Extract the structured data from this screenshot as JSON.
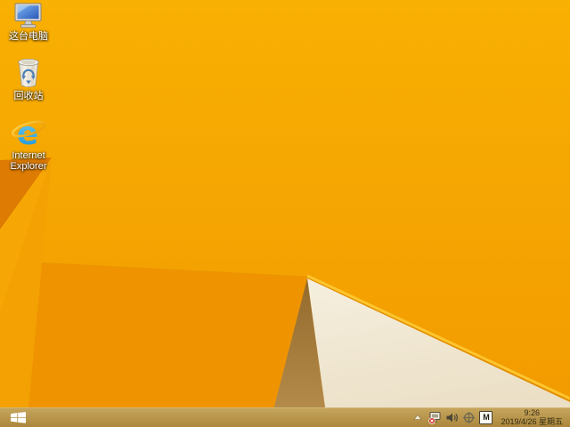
{
  "desktop": {
    "icons": [
      {
        "name": "this-pc",
        "label": "这台电脑"
      },
      {
        "name": "recycle-bin",
        "label": "回收站"
      },
      {
        "name": "internet-explorer",
        "label": "Internet Explorer"
      }
    ]
  },
  "taskbar": {
    "tray": {
      "icon_names": [
        "show-hidden-icons",
        "network-disconnected",
        "volume",
        "input-indicator",
        "ime-mode"
      ],
      "ime_label": "M",
      "time": "9:26",
      "date": "2019/4/26 星期五"
    }
  },
  "colors": {
    "wallpaper_top": "#f8b002",
    "wallpaper_bottom": "#f19500",
    "facet_dark": "#dd7b02",
    "facet_cream": "#f2ecda",
    "facet_tan": "#a87d3e",
    "ridge_highlight": "#ffc52e",
    "taskbar": "#b9984e",
    "ie_blue": "#2fb3ea",
    "ie_gold": "#f0b93c",
    "network_error_badge": "#cf2a21"
  }
}
